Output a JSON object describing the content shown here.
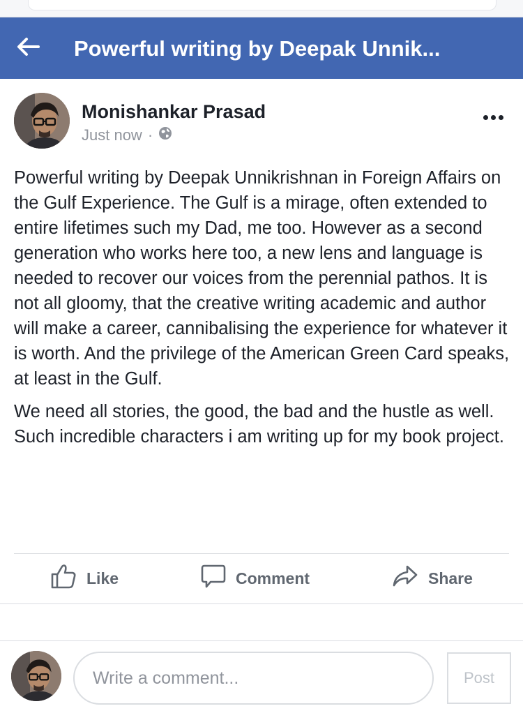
{
  "header": {
    "title": "Powerful writing by Deepak Unnik...",
    "back_icon": "arrow-left-icon",
    "background": "#4267b2"
  },
  "post": {
    "author": "Monishankar Prasad",
    "timestamp": "Just now",
    "separator": "·",
    "privacy_icon": "globe-icon",
    "more_icon": "more-options-icon",
    "paragraphs": [
      "Powerful writing by Deepak Unnikrishnan in Foreign Affairs on the Gulf Experience. The Gulf is a mirage, often extended to entire lifetimes such my Dad, me too. However as a second generation who works here too, a new lens and language is needed to recover our voices from the perennial pathos. It is not all gloomy, that the creative writing academic and author will make a career, cannibalising the experience for whatever it is worth. And the privilege of the American Green Card speaks, at least in the Gulf.",
      "We need all stories, the good, the bad and the hustle as well. Such incredible characters i am writing up for my book project."
    ]
  },
  "actions": {
    "like": {
      "label": "Like",
      "icon": "thumbs-up-icon"
    },
    "comment": {
      "label": "Comment",
      "icon": "speech-bubble-icon"
    },
    "share": {
      "label": "Share",
      "icon": "share-arrow-icon"
    }
  },
  "comment_bar": {
    "placeholder": "Write a comment...",
    "post_label": "Post"
  }
}
